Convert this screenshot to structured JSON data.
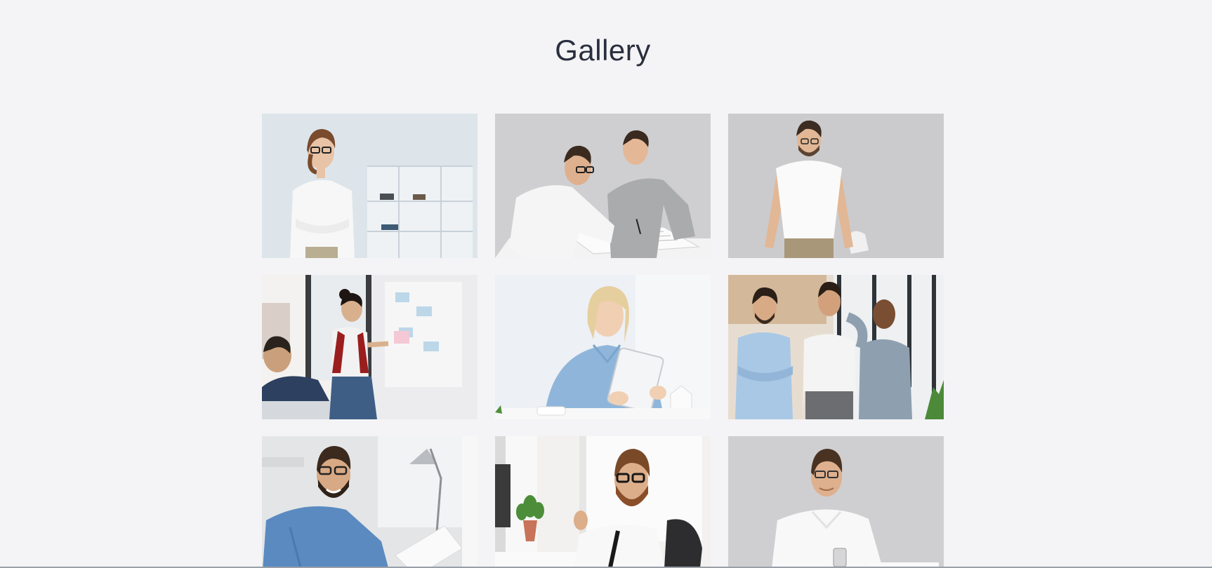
{
  "gallery": {
    "title": "Gallery",
    "tiles": [
      {
        "name": "woman-arms-crossed-photo",
        "bg": "#dfe6ec"
      },
      {
        "name": "two-men-reviewing-plans-photo",
        "bg": "#cfcfd1"
      },
      {
        "name": "man-white-tshirt-photo",
        "bg": "#cbcbcd"
      },
      {
        "name": "woman-presenting-board-photo",
        "bg": "#e9e9eb"
      },
      {
        "name": "blonde-woman-tablet-photo",
        "bg": "#edf0f4"
      },
      {
        "name": "three-men-standing-photo",
        "bg": "#e8e2d8"
      },
      {
        "name": "man-denim-shirt-desk-photo",
        "bg": "#e4e6e8"
      },
      {
        "name": "bearded-man-office-chair-photo",
        "bg": "#f2f2f0"
      },
      {
        "name": "man-white-shirt-phone-photo",
        "bg": "#cfcfd1"
      }
    ]
  }
}
